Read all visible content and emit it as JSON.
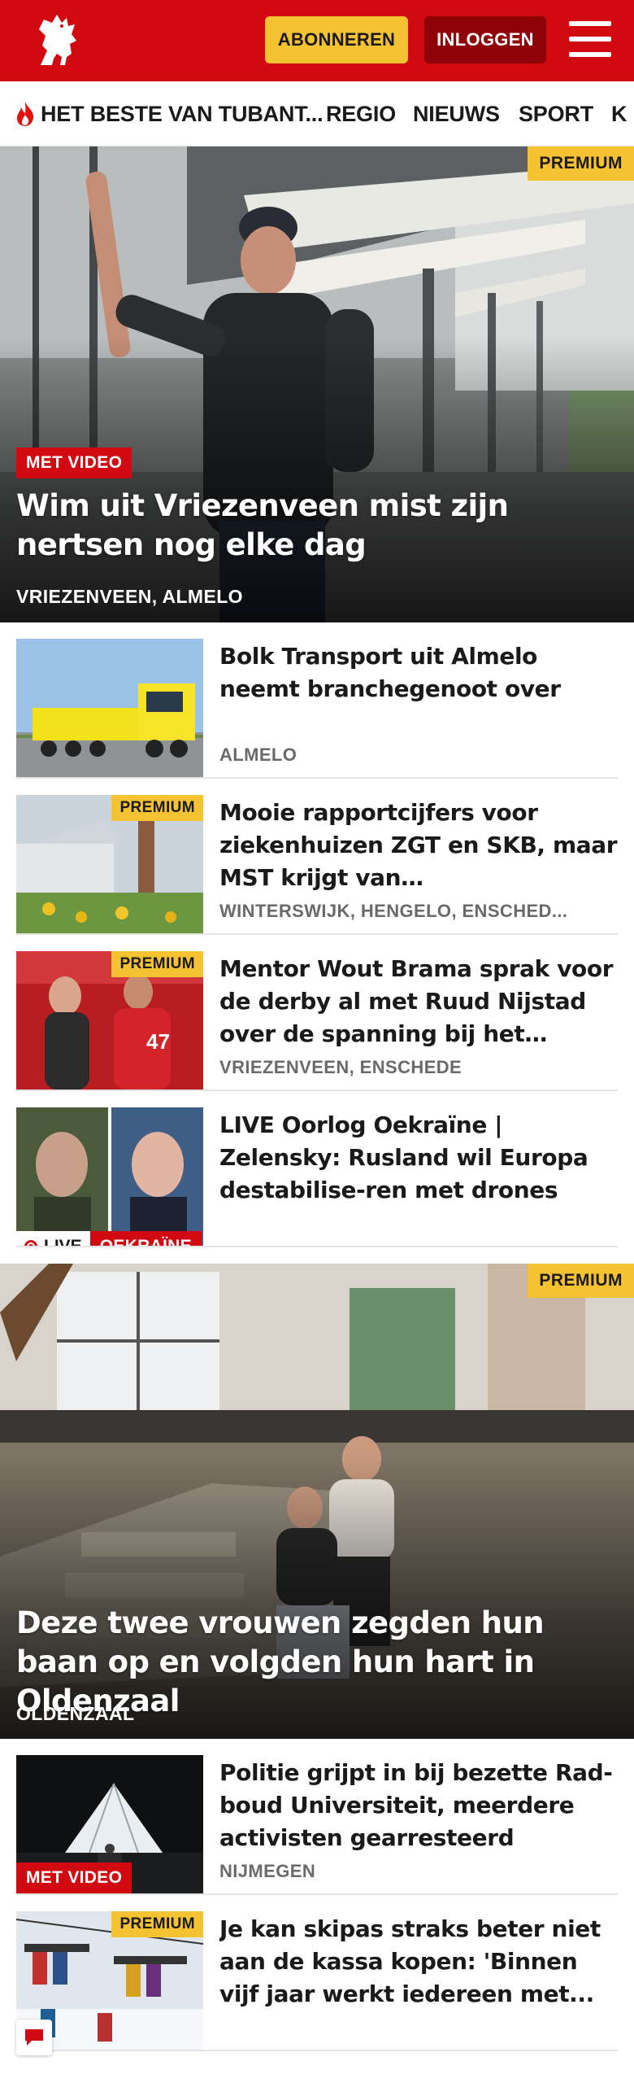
{
  "header": {
    "brand_color": "#d10a11",
    "logo_icon": "tubantia-horse-logo",
    "subscribe_label": "ABONNEREN",
    "login_label": "INLOGGEN",
    "menu_icon": "hamburger-menu-icon"
  },
  "nav": {
    "items": [
      {
        "label": "HET BESTE VAN TUBANT...",
        "icon": "flame-icon"
      },
      {
        "label": "REGIO"
      },
      {
        "label": "NIEUWS"
      },
      {
        "label": "SPORT"
      },
      {
        "label": "K"
      }
    ]
  },
  "hero1": {
    "premium_label": "PREMIUM",
    "video_label": "MET VIDEO",
    "title": "Wim uit Vriezenveen mist zijn nertsen nog elke dag",
    "location": "VRIEZENVEEN, ALMELO"
  },
  "articles": [
    {
      "title": "Bolk Transport uit Almelo neemt branchegenoot over",
      "location": "ALMELO"
    },
    {
      "premium_label": "PREMIUM",
      "title": "Mooie rapportcijfers voor ziekenhuizen ZGT en SKB, maar MST krijgt van accountantsorg...",
      "location": "WINTERSWIJK, HENGELO, ENSCHED..."
    },
    {
      "premium_label": "PREMIUM",
      "title": "Mentor Wout Brama sprak voor de derby al met Ruud Nijstad over de spanning bij het debuut",
      "location": "VRIEZENVEEN, ENSCHEDE"
    },
    {
      "title": "LIVE Oorlog Oekraïne | Zelensky: Rusland wil Europa destabilise-ren met drones",
      "live_label": "LIVE",
      "topic_label": "OEKRAÏNE"
    }
  ],
  "hero2": {
    "premium_label": "PREMIUM",
    "title": "Deze twee vrouwen zegden hun baan op en volgden hun hart in Oldenzaal",
    "location": "OLDENZAAL"
  },
  "articles2": [
    {
      "video_label": "MET VIDEO",
      "title": "Politie grijpt in bij bezette Rad-boud Universiteit, meerdere activisten gearresteerd",
      "location": "NIJMEGEN"
    },
    {
      "premium_label": "PREMIUM",
      "title": "Je kan skipas straks beter niet aan de kassa kopen: 'Binnen vijf jaar werkt iedereen met..."
    }
  ],
  "chat_icon": "chat-bubble-icon"
}
